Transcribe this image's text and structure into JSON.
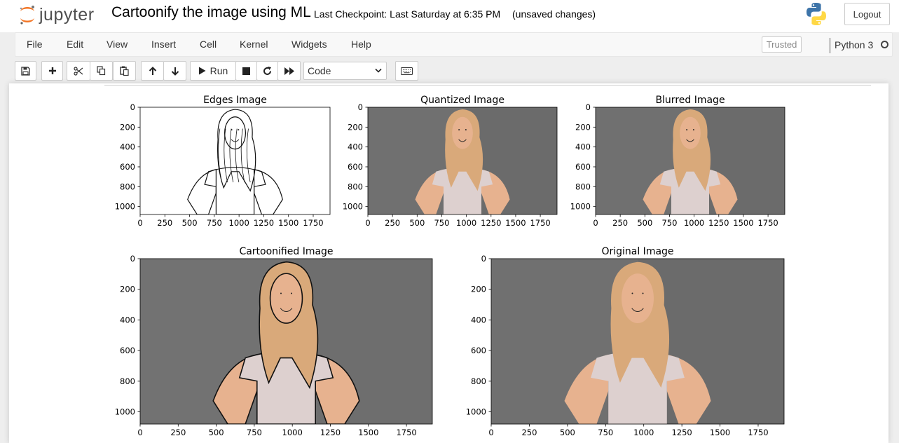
{
  "header": {
    "logo_text": "jupyter",
    "notebook_title": "Cartoonify the image using ML",
    "checkpoint": "Last Checkpoint: Last Saturday at 6:35 PM",
    "unsaved": "(unsaved changes)",
    "logout_label": "Logout"
  },
  "menu": {
    "items": [
      "File",
      "Edit",
      "View",
      "Insert",
      "Cell",
      "Kernel",
      "Widgets",
      "Help"
    ],
    "trusted_label": "Trusted",
    "kernel_name": "Python 3"
  },
  "toolbar": {
    "run_label": "Run",
    "cell_type": "Code"
  },
  "colors": {
    "jupyter_orange": "#f37626",
    "background": "#eeeeee",
    "wall_gray": "#6b6b6b",
    "shirt": "#ddd0cf",
    "hair": "#d9a97a",
    "skin": "#e7b28f"
  },
  "figure": {
    "plots": [
      {
        "title": "Edges Image",
        "xticks": [
          "0",
          "250",
          "500",
          "750",
          "1000",
          "1250",
          "1500",
          "1750"
        ],
        "yticks": [
          "0",
          "200",
          "400",
          "600",
          "800",
          "1000"
        ],
        "style": "edges"
      },
      {
        "title": "Quantized Image",
        "xticks": [
          "0",
          "250",
          "500",
          "750",
          "1000",
          "1250",
          "1500",
          "1750"
        ],
        "yticks": [
          "0",
          "200",
          "400",
          "600",
          "800",
          "1000"
        ],
        "style": "photo"
      },
      {
        "title": "Blurred Image",
        "xticks": [
          "0",
          "250",
          "500",
          "750",
          "1000",
          "1250",
          "1500",
          "1750"
        ],
        "yticks": [
          "0",
          "200",
          "400",
          "600",
          "800",
          "1000"
        ],
        "style": "photo"
      },
      {
        "title": "Cartoonified Image",
        "xticks": [
          "0",
          "250",
          "500",
          "750",
          "1000",
          "1250",
          "1500",
          "1750"
        ],
        "yticks": [
          "0",
          "200",
          "400",
          "600",
          "800",
          "1000"
        ],
        "style": "cartoon"
      },
      {
        "title": "Original Image",
        "xticks": [
          "0",
          "250",
          "500",
          "750",
          "1000",
          "1250",
          "1500",
          "1750"
        ],
        "yticks": [
          "0",
          "200",
          "400",
          "600",
          "800",
          "1000"
        ],
        "style": "photo"
      }
    ]
  }
}
